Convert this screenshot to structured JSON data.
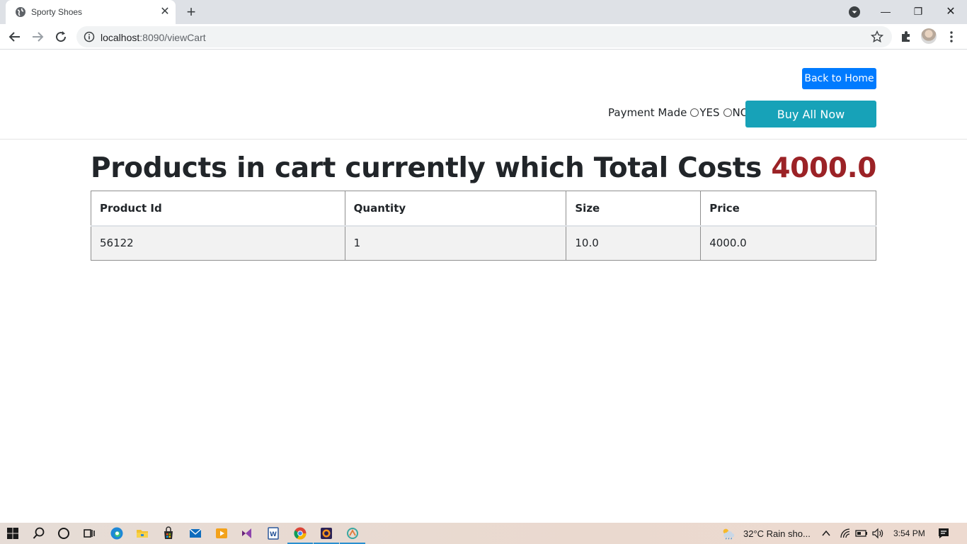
{
  "browser": {
    "tab_title": "Sporty Shoes",
    "url_host": "localhost",
    "url_path": ":8090/viewCart"
  },
  "page": {
    "back_home_label": "Back to Home",
    "payment_label": "Payment Made",
    "payment_yes": "YES",
    "payment_no": "NO",
    "buy_all_label": "Buy All Now",
    "heading_text": "Products in cart currently which Total Costs",
    "heading_total": "4000.0",
    "table": {
      "headers": [
        "Product Id",
        "Quantity",
        "Size",
        "Price"
      ],
      "rows": [
        [
          "56122",
          "1",
          "10.0",
          "4000.0"
        ]
      ]
    }
  },
  "taskbar": {
    "weather": "32°C  Rain sho...",
    "time": "3:54 PM"
  },
  "colors": {
    "primary_button": "#007bff",
    "info_button": "#17a2b8",
    "total_highlight": "#9b2226"
  }
}
